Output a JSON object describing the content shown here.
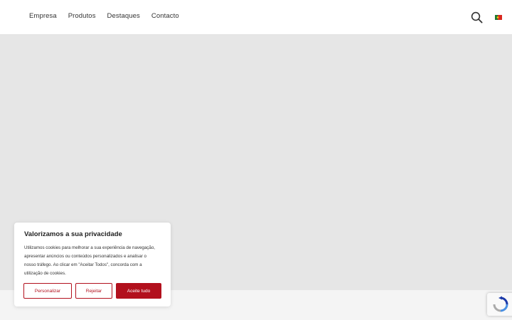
{
  "nav": {
    "items": [
      {
        "label": "Empresa"
      },
      {
        "label": "Produtos"
      },
      {
        "label": "Destaques"
      },
      {
        "label": "Contacto"
      }
    ]
  },
  "header": {
    "search_icon": "search-icon",
    "language_flag": "portugal-flag-icon"
  },
  "cookie_banner": {
    "title": "Valorizamos a sua privacidade",
    "body": "Utilizamos cookies para melhorar a sua experiência de navegação, apresentar anúncios ou conteúdos personalizados e analisar o nosso tráfego. Ao clicar em \"Aceitar Todos\", concorda com a utilização de cookies.",
    "buttons": {
      "customize": "Personalizar",
      "reject": "Rejeitar",
      "accept": "Aceite tudo"
    }
  },
  "colors": {
    "accent": "#b2101d",
    "hero_placeholder": "#e6e6e6",
    "page_background": "#f4f4f4"
  },
  "recaptcha": {
    "icon": "recaptcha-icon"
  }
}
